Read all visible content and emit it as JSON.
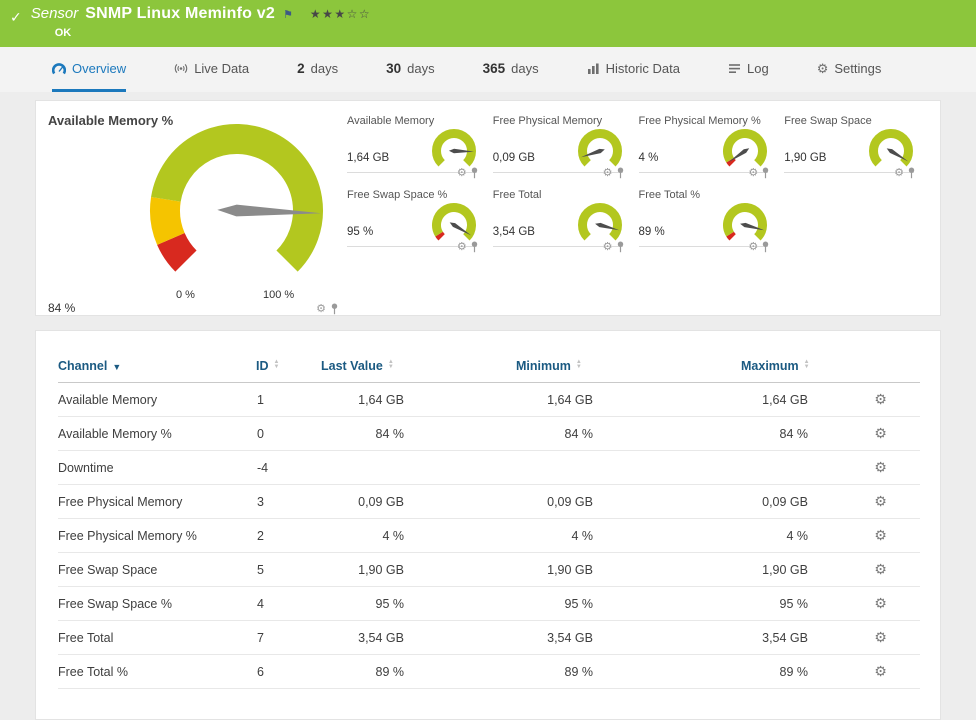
{
  "header": {
    "kind_label": "Sensor",
    "title": "SNMP Linux Meminfo v2",
    "status": "OK",
    "stars": "★★★☆☆",
    "bg_color": "#8cc63c"
  },
  "tabs": [
    {
      "label": "Overview",
      "icon": "gauge-icon",
      "active": true
    },
    {
      "label": "Live Data",
      "icon": "live-icon",
      "active": false
    },
    {
      "num": "2",
      "label": "days",
      "active": false
    },
    {
      "num": "30",
      "label": "days",
      "active": false
    },
    {
      "num": "365",
      "label": "days",
      "active": false
    },
    {
      "label": "Historic Data",
      "icon": "bar-chart-icon",
      "active": false
    },
    {
      "label": "Log",
      "icon": "log-icon",
      "active": false
    },
    {
      "label": "Settings",
      "icon": "gear-icon",
      "active": false
    }
  ],
  "colors": {
    "gauge_green": "#b3c71f",
    "gauge_yellow": "#f5c400",
    "gauge_red": "#d8291f",
    "needle_big": "#8b8b8b",
    "needle_small": "#4d4d4d",
    "accent_blue": "#1c79bd"
  },
  "main_gauge": {
    "title": "Available Memory %",
    "value_label": "84 %",
    "value_pct": 84,
    "scale_min_label": "0 %",
    "scale_max_label": "100 %",
    "segments": [
      {
        "from": 0,
        "to": 8,
        "color_key": "gauge_red"
      },
      {
        "from": 8,
        "to": 20,
        "color_key": "gauge_yellow"
      },
      {
        "from": 20,
        "to": 100,
        "color_key": "gauge_green"
      }
    ]
  },
  "small_gauges": [
    {
      "title": "Available Memory",
      "value_label": "1,64 GB",
      "value_pct": 84,
      "segments": [
        {
          "from": 0,
          "to": 100,
          "color_key": "gauge_green"
        }
      ]
    },
    {
      "title": "Free Physical Memory",
      "value_label": "0,09 GB",
      "value_pct": 10,
      "segments": [
        {
          "from": 0,
          "to": 100,
          "color_key": "gauge_green"
        }
      ]
    },
    {
      "title": "Free Physical Memory %",
      "value_label": "4 %",
      "value_pct": 4,
      "segments": [
        {
          "from": 0,
          "to": 5,
          "color_key": "gauge_red"
        },
        {
          "from": 5,
          "to": 100,
          "color_key": "gauge_green"
        }
      ]
    },
    {
      "title": "Free Swap Space",
      "value_label": "1,90 GB",
      "value_pct": 95,
      "segments": [
        {
          "from": 0,
          "to": 100,
          "color_key": "gauge_green"
        }
      ]
    },
    {
      "title": "Free Swap Space %",
      "value_label": "95 %",
      "value_pct": 95,
      "segments": [
        {
          "from": 0,
          "to": 5,
          "color_key": "gauge_red"
        },
        {
          "from": 5,
          "to": 100,
          "color_key": "gauge_green"
        }
      ]
    },
    {
      "title": "Free Total",
      "value_label": "3,54 GB",
      "value_pct": 89,
      "segments": [
        {
          "from": 0,
          "to": 100,
          "color_key": "gauge_green"
        }
      ]
    },
    {
      "title": "Free Total %",
      "value_label": "89 %",
      "value_pct": 89,
      "segments": [
        {
          "from": 0,
          "to": 5,
          "color_key": "gauge_red"
        },
        {
          "from": 5,
          "to": 100,
          "color_key": "gauge_green"
        }
      ]
    }
  ],
  "table": {
    "columns": [
      {
        "label": "Channel",
        "sort": "active-desc"
      },
      {
        "label": "ID",
        "sort": "both"
      },
      {
        "label": "Last Value",
        "sort": "both"
      },
      {
        "label": "Minimum",
        "sort": "both"
      },
      {
        "label": "Maximum",
        "sort": "both"
      }
    ],
    "rows": [
      {
        "channel": "Available Memory",
        "id": "1",
        "last": "1,64 GB",
        "min": "1,64 GB",
        "max": "1,64 GB"
      },
      {
        "channel": "Available Memory %",
        "id": "0",
        "last": "84 %",
        "min": "84 %",
        "max": "84 %"
      },
      {
        "channel": "Downtime",
        "id": "-4",
        "last": "",
        "min": "",
        "max": ""
      },
      {
        "channel": "Free Physical Memory",
        "id": "3",
        "last": "0,09 GB",
        "min": "0,09 GB",
        "max": "0,09 GB"
      },
      {
        "channel": "Free Physical Memory %",
        "id": "2",
        "last": "4 %",
        "min": "4 %",
        "max": "4 %"
      },
      {
        "channel": "Free Swap Space",
        "id": "5",
        "last": "1,90 GB",
        "min": "1,90 GB",
        "max": "1,90 GB"
      },
      {
        "channel": "Free Swap Space %",
        "id": "4",
        "last": "95 %",
        "min": "95 %",
        "max": "95 %"
      },
      {
        "channel": "Free Total",
        "id": "7",
        "last": "3,54 GB",
        "min": "3,54 GB",
        "max": "3,54 GB"
      },
      {
        "channel": "Free Total %",
        "id": "6",
        "last": "89 %",
        "min": "89 %",
        "max": "89 %"
      }
    ]
  }
}
